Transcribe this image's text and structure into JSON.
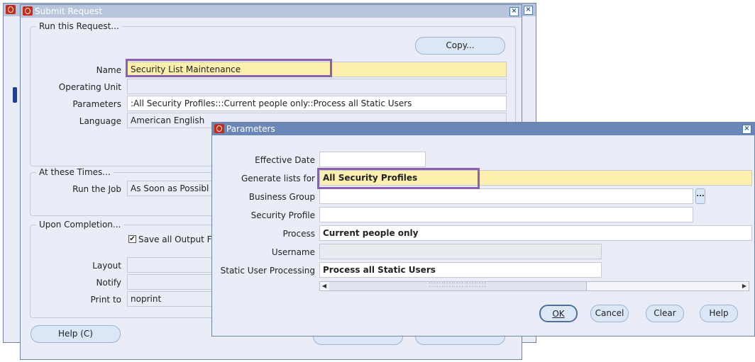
{
  "submit_request": {
    "title": "Submit Request",
    "run_group_label": "Run this Request...",
    "copy_button": "Copy...",
    "fields": {
      "name": {
        "label": "Name",
        "value": "Security List Maintenance"
      },
      "operating_unit": {
        "label": "Operating Unit",
        "value": ""
      },
      "parameters": {
        "label": "Parameters",
        "value": ":All Security Profiles:::Current people only::Process all Static Users"
      },
      "language": {
        "label": "Language",
        "value": "American English"
      }
    },
    "times_group_label": "At these Times...",
    "run_job": {
      "label": "Run the Job",
      "value": "As Soon as Possibl"
    },
    "completion_group_label": "Upon Completion...",
    "save_output": {
      "label": "Save all Output Fi",
      "checked": true
    },
    "layout": {
      "label": "Layout",
      "value": ""
    },
    "notify": {
      "label": "Notify",
      "value": ""
    },
    "print_to": {
      "label": "Print to",
      "value": "noprint"
    },
    "help_button": "Help (C)"
  },
  "parameters_dialog": {
    "title": "Parameters",
    "fields": {
      "effective_date": {
        "label": "Effective Date",
        "value": ""
      },
      "generate_lists_for": {
        "label": "Generate lists for",
        "value": "All Security Profiles"
      },
      "business_group": {
        "label": "Business Group",
        "value": ""
      },
      "security_profile": {
        "label": "Security Profile",
        "value": ""
      },
      "process": {
        "label": "Process",
        "value": "Current people only"
      },
      "username": {
        "label": "Username",
        "value": ""
      },
      "static_user_processing": {
        "label": "Static User Processing",
        "value": "Process all Static Users"
      }
    },
    "lov_button": "...",
    "buttons": {
      "ok": "OK",
      "cancel": "Cancel",
      "clear": "Clear",
      "help": "Help"
    }
  },
  "colors": {
    "highlight": "#8c60b0",
    "required_field": "#fdefad",
    "oracle_red": "#c62b18"
  }
}
